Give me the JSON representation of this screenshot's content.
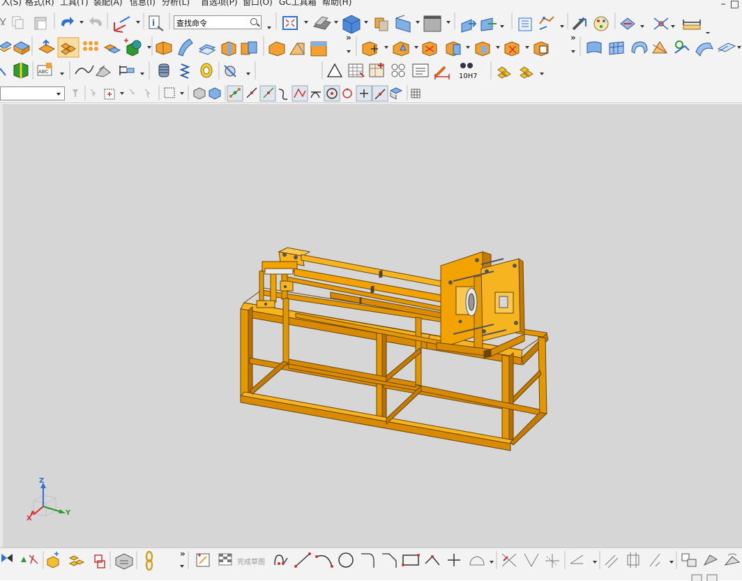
{
  "menubar": {
    "items": [
      "入(S)",
      "格式(R)",
      "工具(T)",
      "装配(A)",
      "信息(I)",
      "分析(L)",
      "首选项(P)",
      "窗口(O)",
      "GC工具箱",
      "帮助(H)"
    ],
    "window_controls": [
      "–",
      "□"
    ]
  },
  "toolbar": {
    "search_placeholder": "查找命令",
    "dimension_label": "10H7",
    "overflow_glyph": "»"
  },
  "selection": {
    "filter_value": ""
  },
  "viewport": {
    "background": "#d6d6d6",
    "model_color": "#f2a300",
    "triad": {
      "z_label": "Z",
      "x_label": "X",
      "y_label": "Y"
    }
  },
  "sketch_toolbar": {
    "finish_sketch_label": "完成草图"
  },
  "colors": {
    "toolbar_bg": "#f3f3f3",
    "accent_blue": "#2f6fd1",
    "model_orange": "#f2a300",
    "model_edge": "#6b4400"
  }
}
